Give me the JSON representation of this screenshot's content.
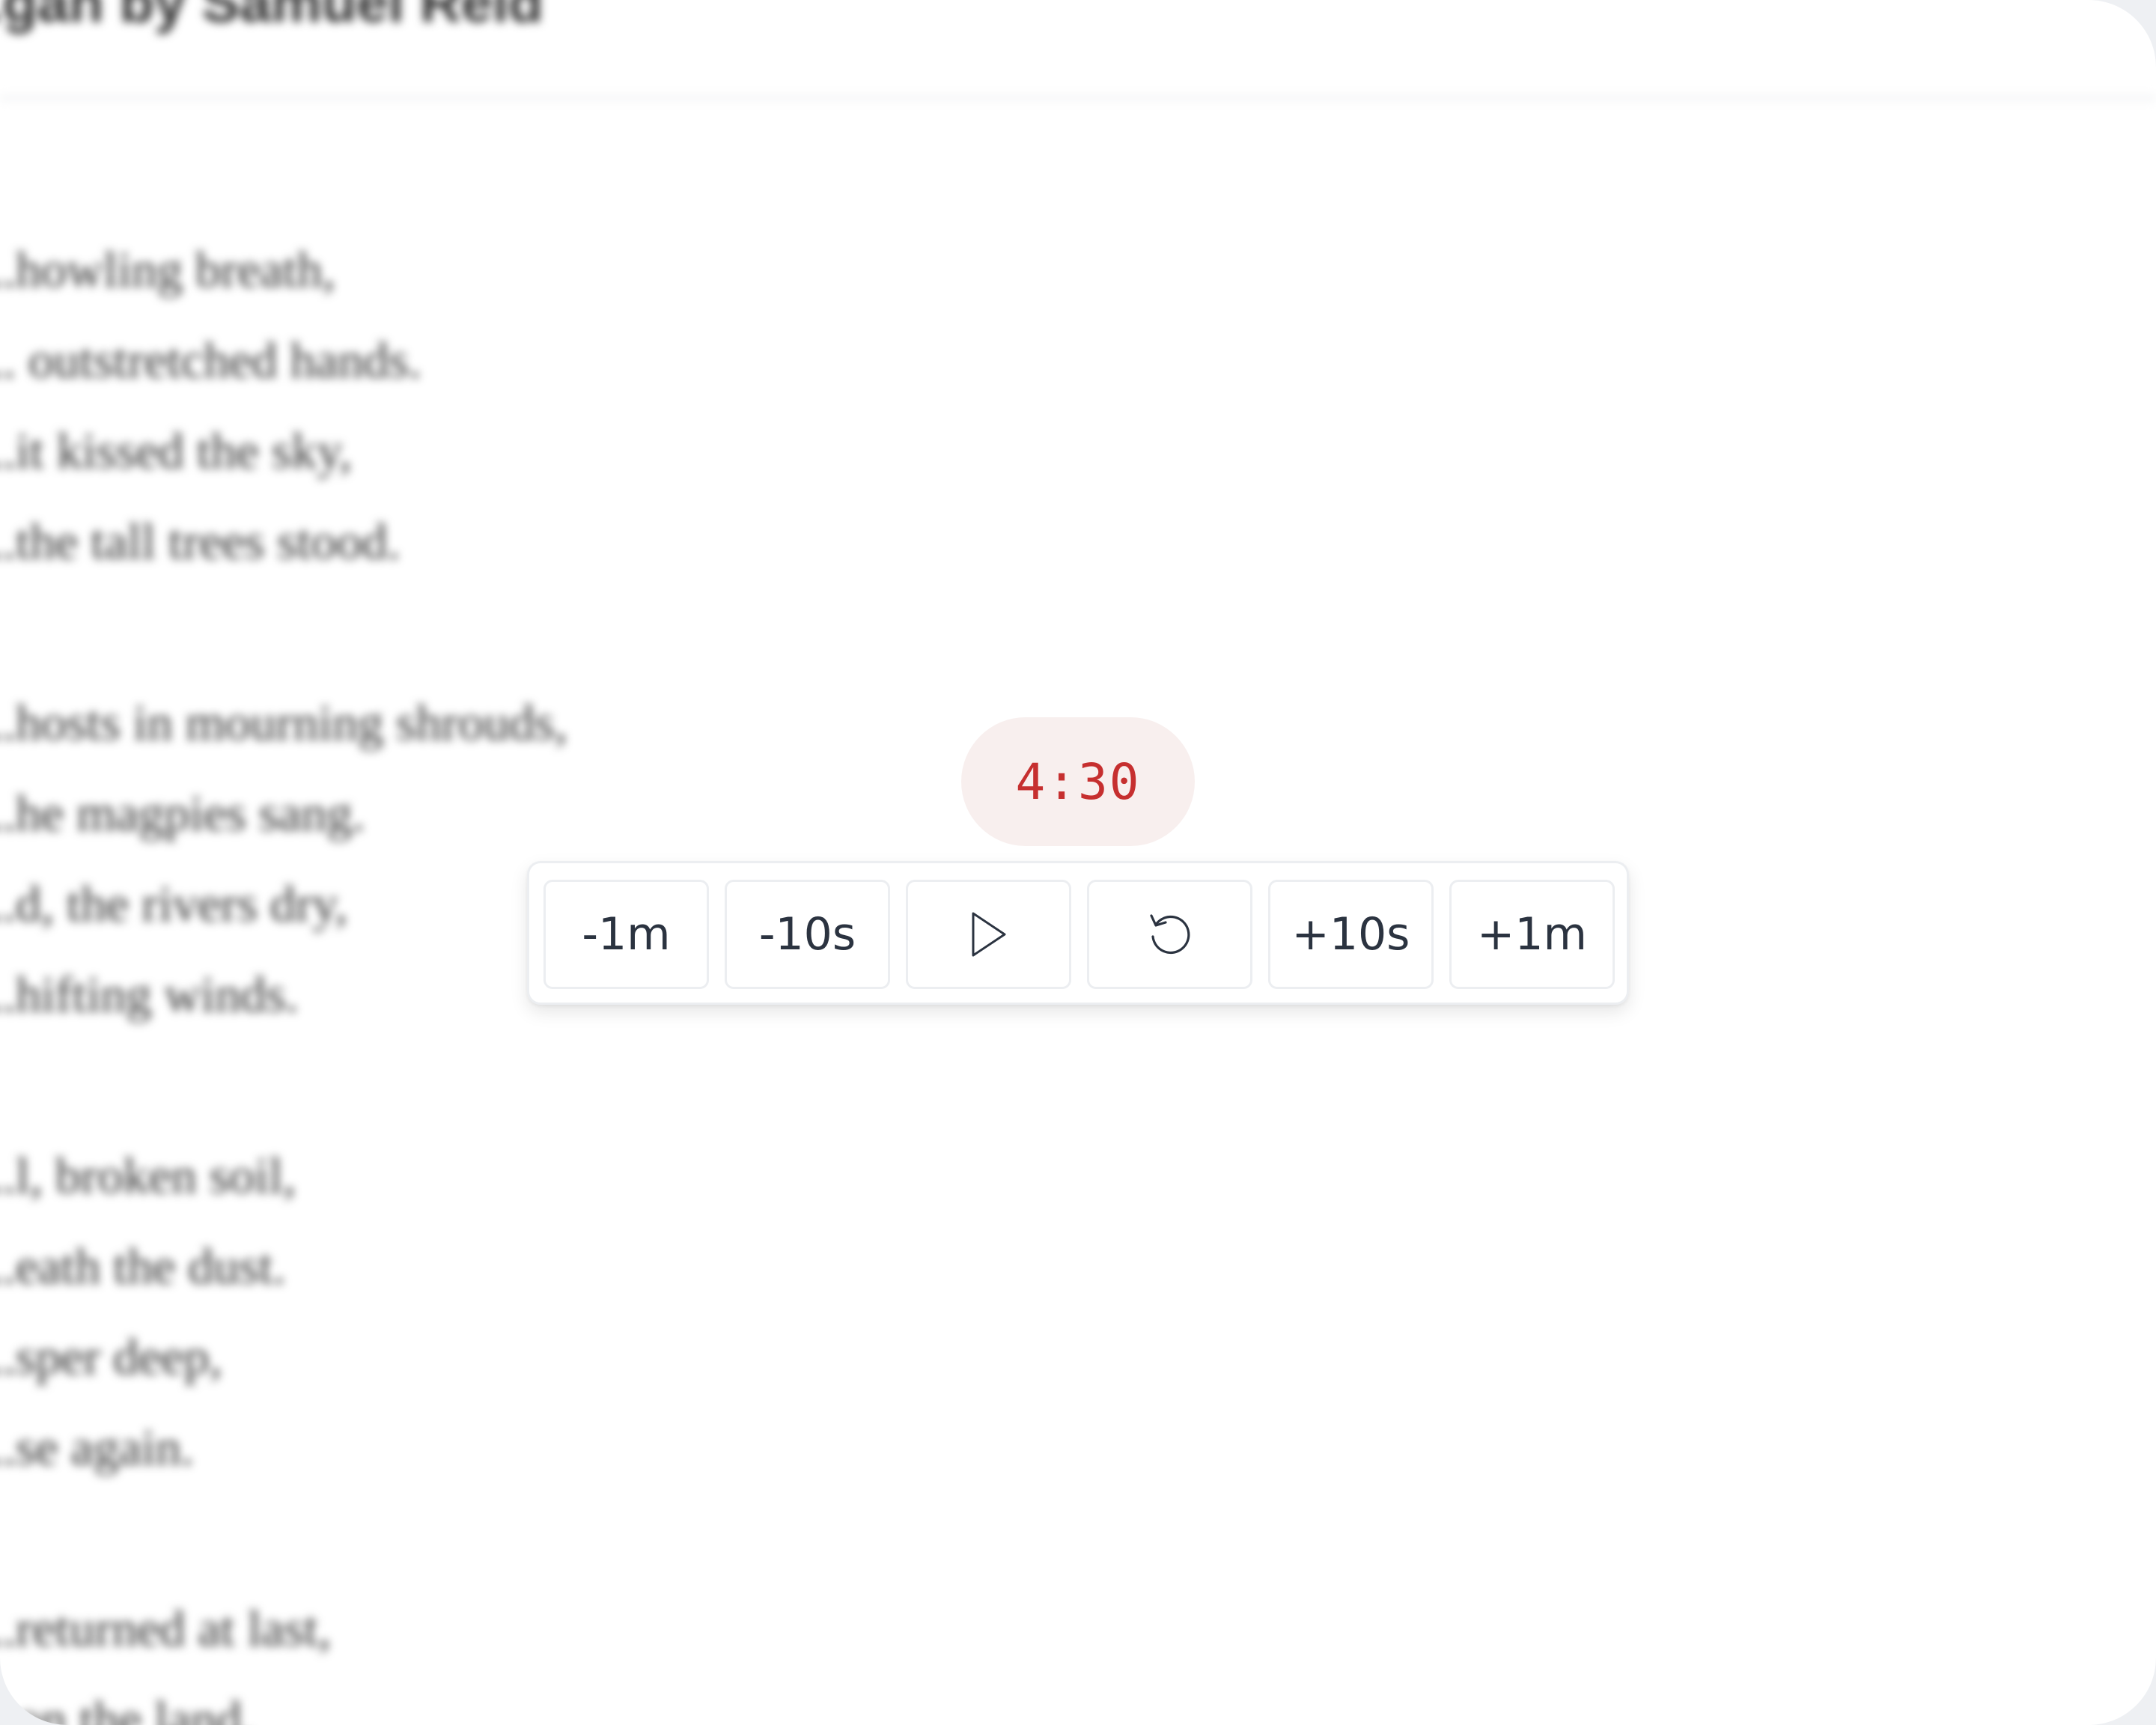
{
  "document": {
    "title": "...gan by Samuel Reid",
    "poem_lines": [
      "...howling breath,",
      "... outstretched hands.",
      "...it kissed the sky,",
      "...the tall trees stood.",
      "",
      "...hosts in mourning shrouds,",
      "...he magpies sang.",
      "...d, the rivers dry,",
      "...hifting winds.",
      "",
      "...l, broken soil,",
      "...eath the dust.",
      "...sper deep,",
      "...se again.",
      "",
      "...returned at last,",
      "...on the land."
    ]
  },
  "timer": {
    "display": "4:30",
    "controls": {
      "minus_1m": "-1m",
      "minus_10s": "-10s",
      "play_icon": "play-icon",
      "reset_icon": "reset-icon",
      "plus_10s": "+10s",
      "plus_1m": "+1m"
    }
  },
  "colors": {
    "timer_text": "#c62f2f",
    "timer_bg": "#f8efee",
    "button_text": "#2b3340"
  }
}
